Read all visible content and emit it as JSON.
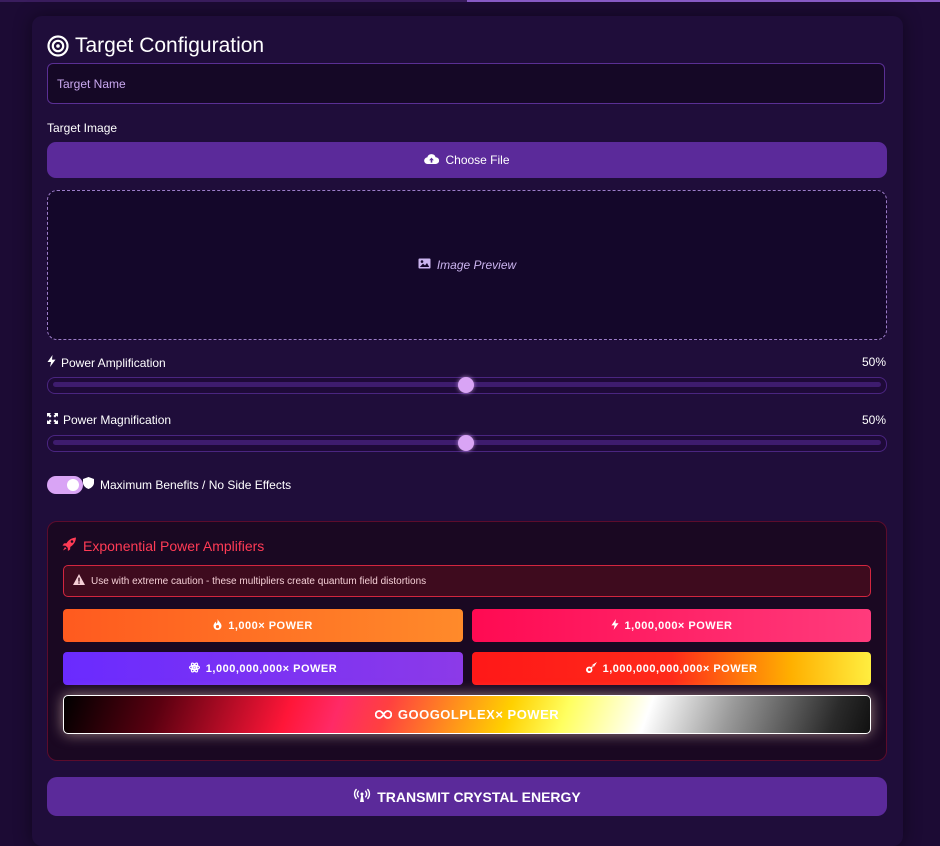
{
  "header": {
    "title": "Target Configuration",
    "icon": "bullseye-icon"
  },
  "target_name": {
    "placeholder": "Target Name",
    "value": ""
  },
  "target_image": {
    "label": "Target Image",
    "choose_file_label": "Choose File",
    "preview_label": "Image Preview"
  },
  "power_amplification": {
    "label": "Power Amplification",
    "value_label": "50%",
    "value": 50
  },
  "power_magnification": {
    "label": "Power Magnification",
    "value_label": "50%",
    "value": 50
  },
  "toggle": {
    "label": "Maximum Benefits / No Side Effects",
    "checked": true
  },
  "amplifiers": {
    "title": "Exponential Power Amplifiers",
    "warning": "Use with extreme caution - these multipliers create quantum field distortions",
    "buttons": [
      {
        "label": "1,000× POWER",
        "icon": "fire-icon"
      },
      {
        "label": "1,000,000× POWER",
        "icon": "bolt-icon"
      },
      {
        "label": "1,000,000,000× POWER",
        "icon": "atom-icon"
      },
      {
        "label": "1,000,000,000,000× POWER",
        "icon": "meteor-icon"
      }
    ],
    "googolplex_label": "GOOGOLPLEX× POWER"
  },
  "transmit": {
    "label": "TRANSMIT CRYSTAL ENERGY",
    "icon": "broadcast-tower-icon"
  },
  "colors": {
    "background": "#1c0b34",
    "panel": "#1f0d3a",
    "accent": "#5b2a9a",
    "thumb": "#d9a4f5",
    "danger": "#ff3b55"
  }
}
